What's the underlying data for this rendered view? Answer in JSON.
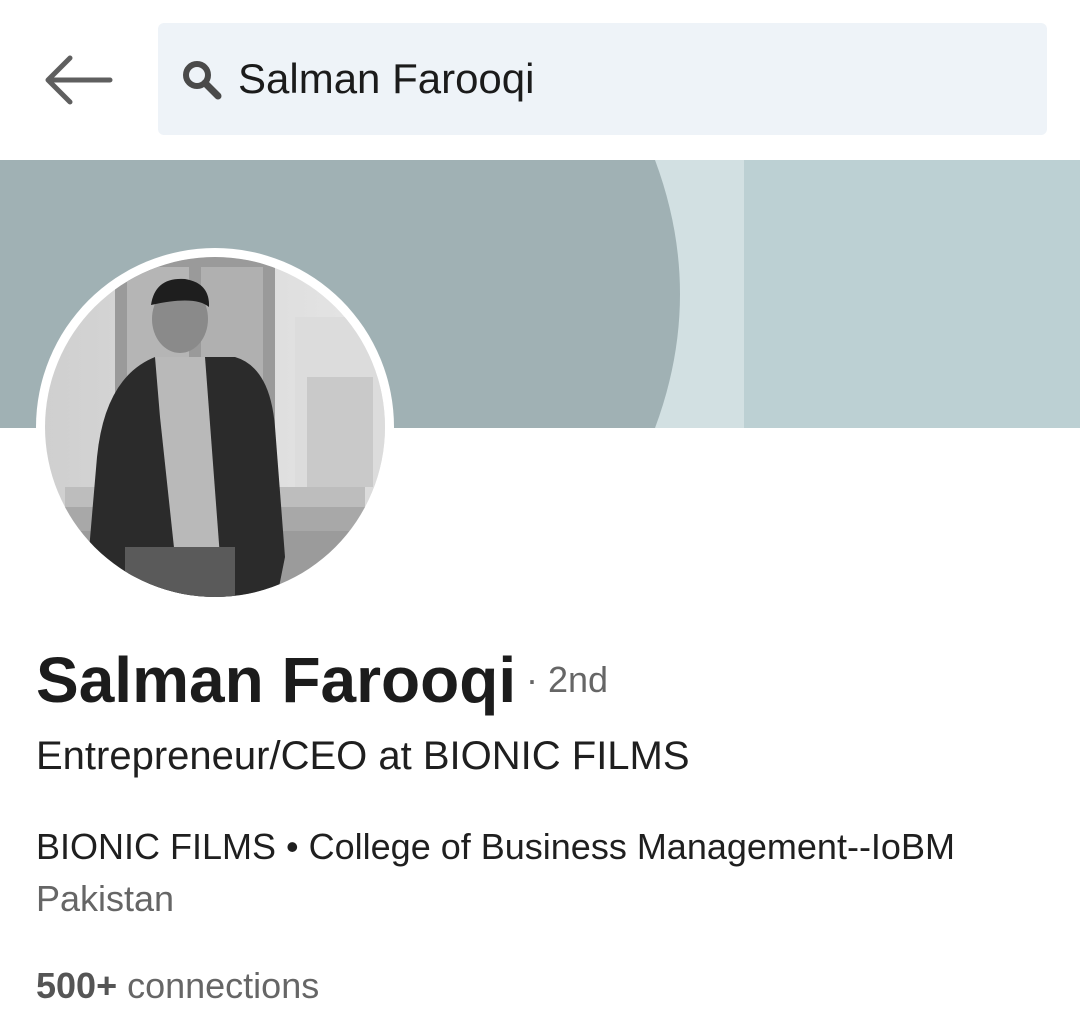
{
  "search": {
    "query": "Salman Farooqi"
  },
  "profile": {
    "name": "Salman Farooqi",
    "degree": "· 2nd",
    "headline": "Entrepreneur/CEO at BIONIC FILMS",
    "current": "BIONIC FILMS • College of Business Management--IoBM",
    "location": "Pakistan",
    "connections_count": "500+",
    "connections_label": " connections"
  },
  "colors": {
    "search_bg": "#eef3f8",
    "banner_left": "#a0b1b4",
    "banner_mid": "#d2e0e2",
    "banner_right": "#bcd0d3"
  },
  "icons": {
    "back": "arrow-left-icon",
    "search": "search-icon"
  }
}
